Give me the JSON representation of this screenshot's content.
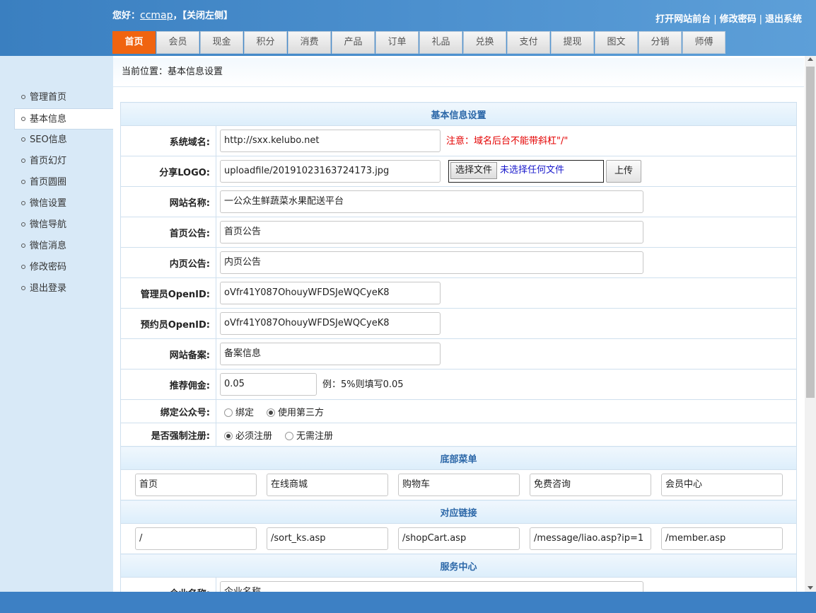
{
  "header": {
    "greeting_prefix": "您好：",
    "username": "ccmap",
    "greeting_suffix": "，【关闭左侧】",
    "links": [
      "打开网站前台",
      "修改密码",
      "退出系统"
    ],
    "separator": "|"
  },
  "nav": {
    "tabs": [
      "首页",
      "会员",
      "现金",
      "积分",
      "消费",
      "产品",
      "订单",
      "礼品",
      "兑换",
      "支付",
      "提现",
      "图文",
      "分销",
      "师傅"
    ],
    "active": "首页"
  },
  "sidebar": {
    "items": [
      "管理首页",
      "基本信息",
      "SEO信息",
      "首页幻灯",
      "首页圆圈",
      "微信设置",
      "微信导航",
      "微信消息",
      "修改密码",
      "退出登录"
    ],
    "active": "基本信息"
  },
  "breadcrumb": {
    "prefix": "当前位置：",
    "current": "基本信息设置"
  },
  "form": {
    "section_title": "基本信息设置",
    "domain": {
      "label": "系统域名:",
      "value": "http://sxx.kelubo.net",
      "note": "注意：域名后台不能带斜杠\"/\""
    },
    "logo": {
      "label": "分享LOGO:",
      "value": "uploadfile/20191023163724173.jpg",
      "file_button": "选择文件",
      "file_status": "未选择任何文件",
      "upload_button": "上传"
    },
    "site_name": {
      "label": "网站名称:",
      "value": "一公众生鲜蔬菜水果配送平台"
    },
    "home_notice": {
      "label": "首页公告:",
      "value": "首页公告"
    },
    "inner_notice": {
      "label": "内页公告:",
      "value": "内页公告"
    },
    "admin_openid": {
      "label": "管理员OpenID:",
      "value": "oVfr41Y087OhouyWFDSJeWQCyeK8"
    },
    "booking_openid": {
      "label": "预约员OpenID:",
      "value": "oVfr41Y087OhouyWFDSJeWQCyeK8"
    },
    "icp": {
      "label": "网站备案:",
      "value": "备案信息"
    },
    "commission": {
      "label": "推荐佣金:",
      "value": "0.05",
      "note": "例：5%则填写0.05"
    },
    "bind_account": {
      "label": "绑定公众号:",
      "options": [
        "绑定",
        "使用第三方"
      ],
      "selected": "使用第三方"
    },
    "force_register": {
      "label": "是否强制注册:",
      "options": [
        "必须注册",
        "无需注册"
      ],
      "selected": "必须注册"
    }
  },
  "bottom_menu": {
    "title": "底部菜单",
    "items": [
      "首页",
      "在线商城",
      "购物车",
      "免费咨询",
      "会员中心"
    ]
  },
  "links": {
    "title": "对应链接",
    "items": [
      "/",
      "/sort_ks.asp",
      "/shopCart.asp",
      "/message/liao.asp?ip=1",
      "/member.asp"
    ]
  },
  "service": {
    "title": "服务中心",
    "company": {
      "label": "企业名称:",
      "value": "企业名称"
    }
  },
  "colors": {
    "header_blue": "#4a8ccb",
    "active_tab": "#f06410",
    "section_title": "#2b67a8",
    "warning_red": "#e40000"
  }
}
